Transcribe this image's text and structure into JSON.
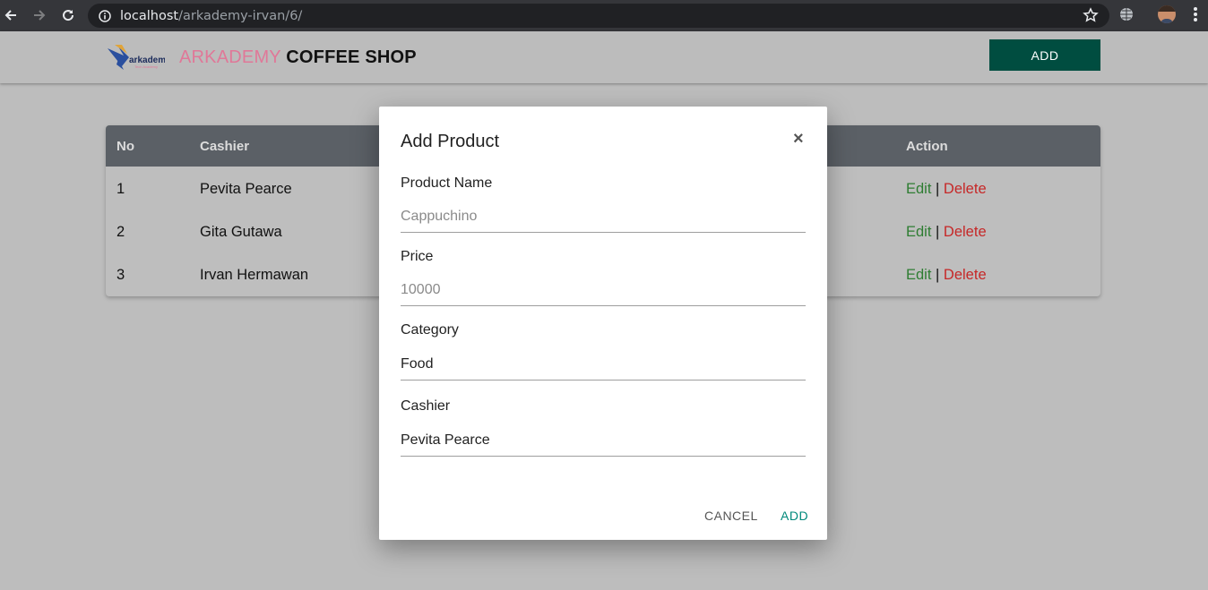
{
  "browser": {
    "url_host": "localhost",
    "url_path": "/arkademy-irvan/6/"
  },
  "navbar": {
    "brand_pink": "ARKADEMY",
    "brand_dark": "COFFEE SHOP",
    "logo_text": "arkademy",
    "add_label": "ADD"
  },
  "table": {
    "headers": {
      "no": "No",
      "cashier": "Cashier",
      "action": "Action"
    },
    "rows": [
      {
        "no": "1",
        "cashier": "Pevita Pearce",
        "edit": "Edit",
        "sep": "|",
        "delete": "Delete"
      },
      {
        "no": "2",
        "cashier": "Gita Gutawa",
        "edit": "Edit",
        "sep": "|",
        "delete": "Delete"
      },
      {
        "no": "3",
        "cashier": "Irvan Hermawan",
        "edit": "Edit",
        "sep": "|",
        "delete": "Delete"
      }
    ]
  },
  "modal": {
    "title": "Add Product",
    "close": "×",
    "fields": {
      "product_name": {
        "label": "Product Name",
        "placeholder": "Cappuchino"
      },
      "price": {
        "label": "Price",
        "placeholder": "10000"
      },
      "category": {
        "label": "Category",
        "value": "Food"
      },
      "cashier": {
        "label": "Cashier",
        "value": "Pevita Pearce"
      }
    },
    "cancel_label": "CANCEL",
    "add_label": "ADD"
  },
  "colors": {
    "brand_pink": "#e07898",
    "nav_button": "#004d40",
    "edit_green": "#2e7d32",
    "delete_red": "#c62828",
    "modal_add_teal": "#00897b"
  }
}
